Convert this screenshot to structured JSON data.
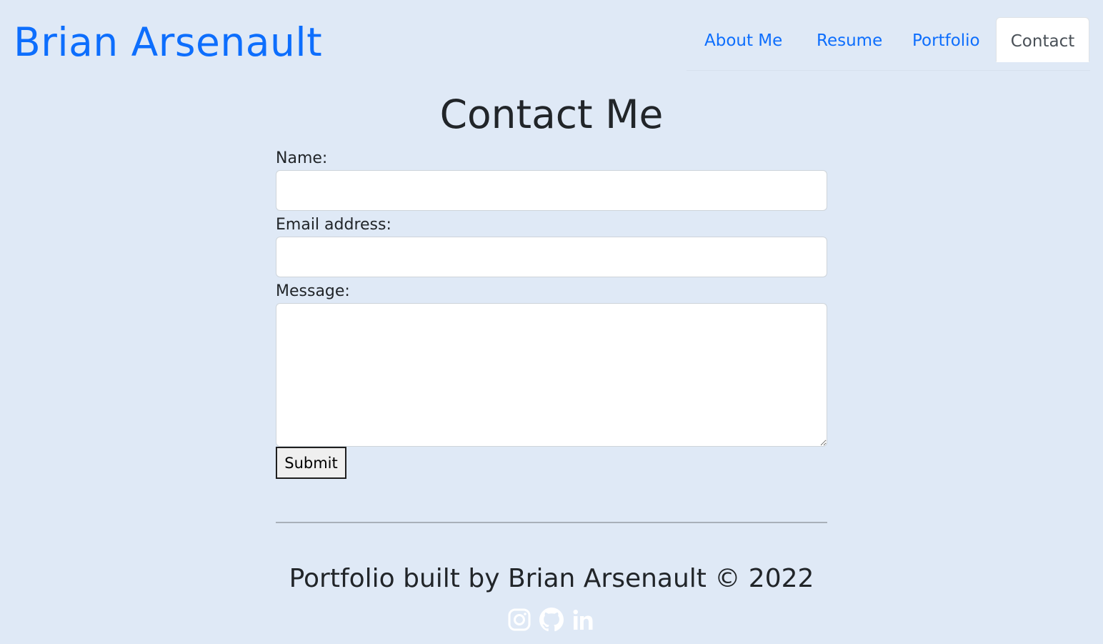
{
  "header": {
    "brand": "Brian Arsenault",
    "brand_color": "#0d6efd",
    "nav": [
      {
        "label": "About Me"
      },
      {
        "label": "Resume"
      },
      {
        "label": "Portfolio"
      },
      {
        "label": "Contact",
        "active": true
      }
    ]
  },
  "contact": {
    "title": "Contact Me",
    "name_label": "Name:",
    "name_value": "",
    "email_label": "Email address:",
    "email_value": "",
    "message_label": "Message:",
    "message_value": "",
    "submit_label": "Submit"
  },
  "footer": {
    "text": "Portfolio built by Brian Arsenault © 2022",
    "socials": [
      {
        "icon": "instagram-icon"
      },
      {
        "icon": "github-icon"
      },
      {
        "icon": "linkedin-icon"
      }
    ]
  },
  "colors": {
    "background": "#dfe9f6",
    "link": "#0d6efd",
    "text": "#212529"
  }
}
